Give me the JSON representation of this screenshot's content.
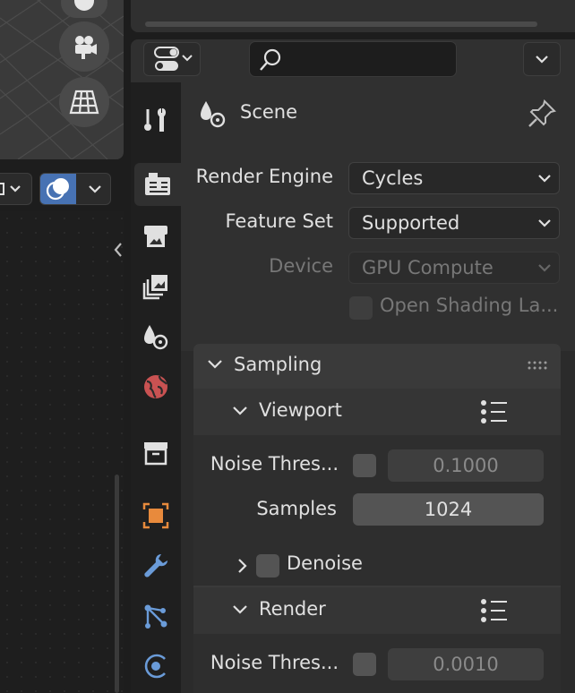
{
  "properties": {
    "context_title": "Scene",
    "rows": {
      "render_engine": {
        "label": "Render Engine",
        "value": "Cycles"
      },
      "feature_set": {
        "label": "Feature Set",
        "value": "Supported"
      },
      "device": {
        "label": "Device",
        "value": "GPU Compute"
      },
      "open_shading": {
        "label": "Open Shading La..."
      }
    },
    "sampling": {
      "title": "Sampling",
      "viewport": {
        "title": "Viewport",
        "noise_threshold": {
          "label": "Noise Thres...",
          "value": "0.1000"
        },
        "samples": {
          "label": "Samples",
          "value": "1024"
        },
        "denoise": {
          "label": "Denoise"
        }
      },
      "render": {
        "title": "Render",
        "noise_threshold": {
          "label": "Noise Thres...",
          "value": "0.0010"
        }
      }
    }
  },
  "tabs": [
    "tool",
    "render",
    "output",
    "view-layer",
    "scene",
    "world",
    "collection",
    "object",
    "modifiers",
    "particles",
    "physics"
  ],
  "colors": {
    "accent_blue": "#4772b3",
    "object_orange": "#e88a3c",
    "world_red": "#c95252",
    "modifier_blue": "#6a9bd8"
  }
}
